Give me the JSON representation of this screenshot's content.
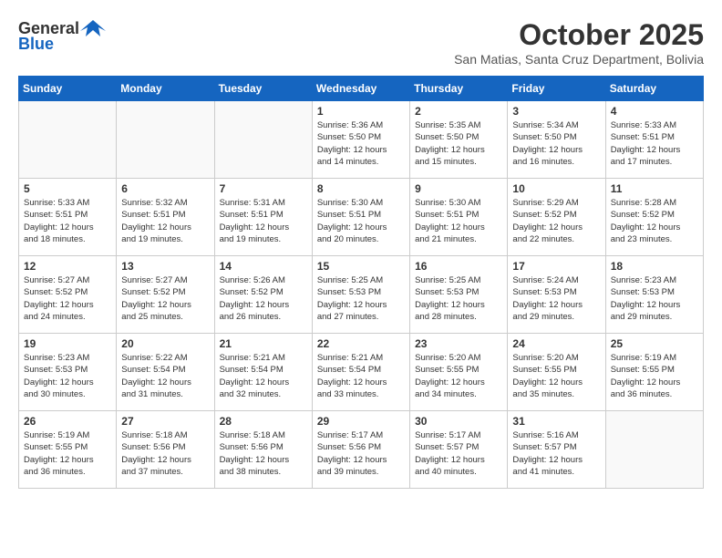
{
  "header": {
    "logo_general": "General",
    "logo_blue": "Blue",
    "month": "October 2025",
    "location": "San Matias, Santa Cruz Department, Bolivia"
  },
  "days_of_week": [
    "Sunday",
    "Monday",
    "Tuesday",
    "Wednesday",
    "Thursday",
    "Friday",
    "Saturday"
  ],
  "weeks": [
    [
      {
        "day": "",
        "content": ""
      },
      {
        "day": "",
        "content": ""
      },
      {
        "day": "",
        "content": ""
      },
      {
        "day": "1",
        "content": "Sunrise: 5:36 AM\nSunset: 5:50 PM\nDaylight: 12 hours\nand 14 minutes."
      },
      {
        "day": "2",
        "content": "Sunrise: 5:35 AM\nSunset: 5:50 PM\nDaylight: 12 hours\nand 15 minutes."
      },
      {
        "day": "3",
        "content": "Sunrise: 5:34 AM\nSunset: 5:50 PM\nDaylight: 12 hours\nand 16 minutes."
      },
      {
        "day": "4",
        "content": "Sunrise: 5:33 AM\nSunset: 5:51 PM\nDaylight: 12 hours\nand 17 minutes."
      }
    ],
    [
      {
        "day": "5",
        "content": "Sunrise: 5:33 AM\nSunset: 5:51 PM\nDaylight: 12 hours\nand 18 minutes."
      },
      {
        "day": "6",
        "content": "Sunrise: 5:32 AM\nSunset: 5:51 PM\nDaylight: 12 hours\nand 19 minutes."
      },
      {
        "day": "7",
        "content": "Sunrise: 5:31 AM\nSunset: 5:51 PM\nDaylight: 12 hours\nand 19 minutes."
      },
      {
        "day": "8",
        "content": "Sunrise: 5:30 AM\nSunset: 5:51 PM\nDaylight: 12 hours\nand 20 minutes."
      },
      {
        "day": "9",
        "content": "Sunrise: 5:30 AM\nSunset: 5:51 PM\nDaylight: 12 hours\nand 21 minutes."
      },
      {
        "day": "10",
        "content": "Sunrise: 5:29 AM\nSunset: 5:52 PM\nDaylight: 12 hours\nand 22 minutes."
      },
      {
        "day": "11",
        "content": "Sunrise: 5:28 AM\nSunset: 5:52 PM\nDaylight: 12 hours\nand 23 minutes."
      }
    ],
    [
      {
        "day": "12",
        "content": "Sunrise: 5:27 AM\nSunset: 5:52 PM\nDaylight: 12 hours\nand 24 minutes."
      },
      {
        "day": "13",
        "content": "Sunrise: 5:27 AM\nSunset: 5:52 PM\nDaylight: 12 hours\nand 25 minutes."
      },
      {
        "day": "14",
        "content": "Sunrise: 5:26 AM\nSunset: 5:52 PM\nDaylight: 12 hours\nand 26 minutes."
      },
      {
        "day": "15",
        "content": "Sunrise: 5:25 AM\nSunset: 5:53 PM\nDaylight: 12 hours\nand 27 minutes."
      },
      {
        "day": "16",
        "content": "Sunrise: 5:25 AM\nSunset: 5:53 PM\nDaylight: 12 hours\nand 28 minutes."
      },
      {
        "day": "17",
        "content": "Sunrise: 5:24 AM\nSunset: 5:53 PM\nDaylight: 12 hours\nand 29 minutes."
      },
      {
        "day": "18",
        "content": "Sunrise: 5:23 AM\nSunset: 5:53 PM\nDaylight: 12 hours\nand 29 minutes."
      }
    ],
    [
      {
        "day": "19",
        "content": "Sunrise: 5:23 AM\nSunset: 5:53 PM\nDaylight: 12 hours\nand 30 minutes."
      },
      {
        "day": "20",
        "content": "Sunrise: 5:22 AM\nSunset: 5:54 PM\nDaylight: 12 hours\nand 31 minutes."
      },
      {
        "day": "21",
        "content": "Sunrise: 5:21 AM\nSunset: 5:54 PM\nDaylight: 12 hours\nand 32 minutes."
      },
      {
        "day": "22",
        "content": "Sunrise: 5:21 AM\nSunset: 5:54 PM\nDaylight: 12 hours\nand 33 minutes."
      },
      {
        "day": "23",
        "content": "Sunrise: 5:20 AM\nSunset: 5:55 PM\nDaylight: 12 hours\nand 34 minutes."
      },
      {
        "day": "24",
        "content": "Sunrise: 5:20 AM\nSunset: 5:55 PM\nDaylight: 12 hours\nand 35 minutes."
      },
      {
        "day": "25",
        "content": "Sunrise: 5:19 AM\nSunset: 5:55 PM\nDaylight: 12 hours\nand 36 minutes."
      }
    ],
    [
      {
        "day": "26",
        "content": "Sunrise: 5:19 AM\nSunset: 5:55 PM\nDaylight: 12 hours\nand 36 minutes."
      },
      {
        "day": "27",
        "content": "Sunrise: 5:18 AM\nSunset: 5:56 PM\nDaylight: 12 hours\nand 37 minutes."
      },
      {
        "day": "28",
        "content": "Sunrise: 5:18 AM\nSunset: 5:56 PM\nDaylight: 12 hours\nand 38 minutes."
      },
      {
        "day": "29",
        "content": "Sunrise: 5:17 AM\nSunset: 5:56 PM\nDaylight: 12 hours\nand 39 minutes."
      },
      {
        "day": "30",
        "content": "Sunrise: 5:17 AM\nSunset: 5:57 PM\nDaylight: 12 hours\nand 40 minutes."
      },
      {
        "day": "31",
        "content": "Sunrise: 5:16 AM\nSunset: 5:57 PM\nDaylight: 12 hours\nand 41 minutes."
      },
      {
        "day": "",
        "content": ""
      }
    ]
  ]
}
